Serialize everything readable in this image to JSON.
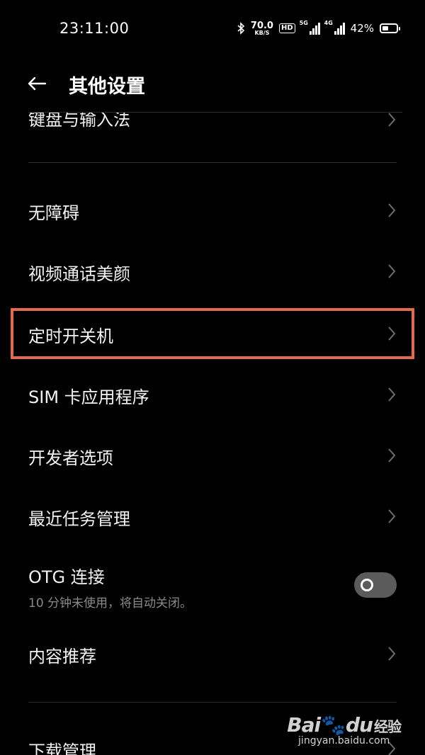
{
  "status_bar": {
    "time": "23:11:00",
    "net_speed_value": "70.0",
    "net_speed_unit": "KB/S",
    "hd_label": "HD",
    "sim1_tag": "5G",
    "sim2_tag": "4G",
    "battery_text": "42%",
    "battery_level": 0.42
  },
  "header": {
    "title": "其他设置"
  },
  "items": {
    "keyboard": {
      "label": "键盘与输入法"
    },
    "accessibility": {
      "label": "无障碍"
    },
    "video_beauty": {
      "label": "视频通话美颜"
    },
    "scheduled_power": {
      "label": "定时开关机"
    },
    "sim_apps": {
      "label": "SIM 卡应用程序"
    },
    "developer": {
      "label": "开发者选项"
    },
    "recent_tasks": {
      "label": "最近任务管理"
    },
    "otg": {
      "label": "OTG 连接",
      "sublabel": "10 分钟未使用，将自动关闭。",
      "enabled": false
    },
    "content_recommend": {
      "label": "内容推荐"
    },
    "downloads": {
      "label": "下载管理"
    }
  },
  "watermark": {
    "logo_left": "Bai",
    "logo_right": "du",
    "logo_cn": "经验",
    "url": "jingyan.baidu.com"
  },
  "colors": {
    "highlight": "#e46a4f",
    "background": "#000000",
    "toggle_off": "#5b5b5b"
  }
}
